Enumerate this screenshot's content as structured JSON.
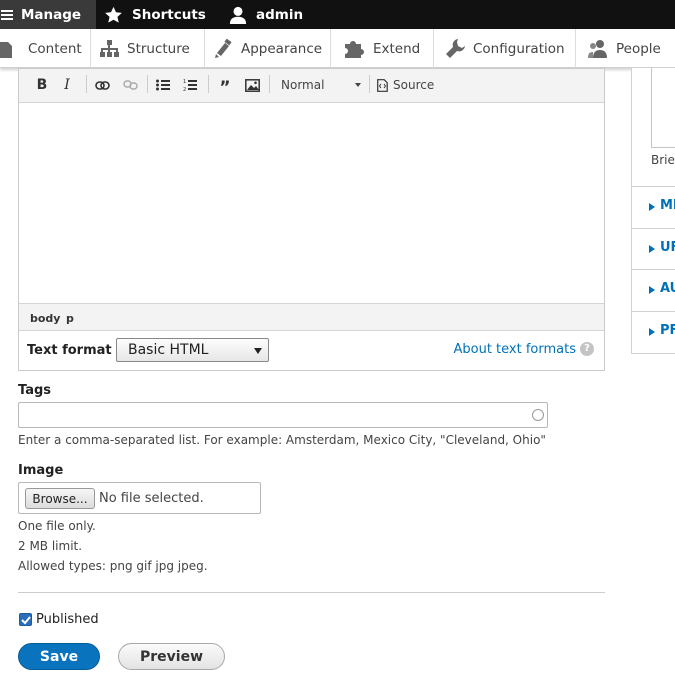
{
  "toolbar": {
    "manage_label": "Manage",
    "shortcuts_label": "Shortcuts",
    "user_label": "admin"
  },
  "tray": {
    "items": [
      {
        "label": "Content",
        "icon": "page-icon"
      },
      {
        "label": "Structure",
        "icon": "structure-icon"
      },
      {
        "label": "Appearance",
        "icon": "paintbrush-icon"
      },
      {
        "label": "Extend",
        "icon": "puzzle-icon"
      },
      {
        "label": "Configuration",
        "icon": "wrench-icon"
      },
      {
        "label": "People",
        "icon": "people-icon"
      }
    ]
  },
  "editor": {
    "heading_format": "Normal",
    "source_label": "Source",
    "path": [
      "body",
      "p"
    ],
    "text_format_label": "Text format",
    "text_format_value": "Basic HTML",
    "about_formats_link": "About text formats"
  },
  "tags": {
    "label": "Tags",
    "value": "",
    "description": "Enter a comma-separated list. For example: Amsterdam, Mexico City, \"Cleveland, Ohio\""
  },
  "image": {
    "label": "Image",
    "browse_label": "Browse...",
    "file_status": "No file selected.",
    "help": [
      "One file only.",
      "2 MB limit.",
      "Allowed types: png gif jpg jpeg."
    ]
  },
  "published": {
    "label": "Published",
    "checked": true
  },
  "actions": {
    "save_label": "Save",
    "preview_label": "Preview"
  },
  "sidebar": {
    "brief_text": "Brie",
    "sections": [
      "MI",
      "UF",
      "AU",
      "PF"
    ]
  },
  "colors": {
    "accent": "#0a73bd",
    "link": "#0071b8",
    "toolbar_bg": "#111111"
  }
}
